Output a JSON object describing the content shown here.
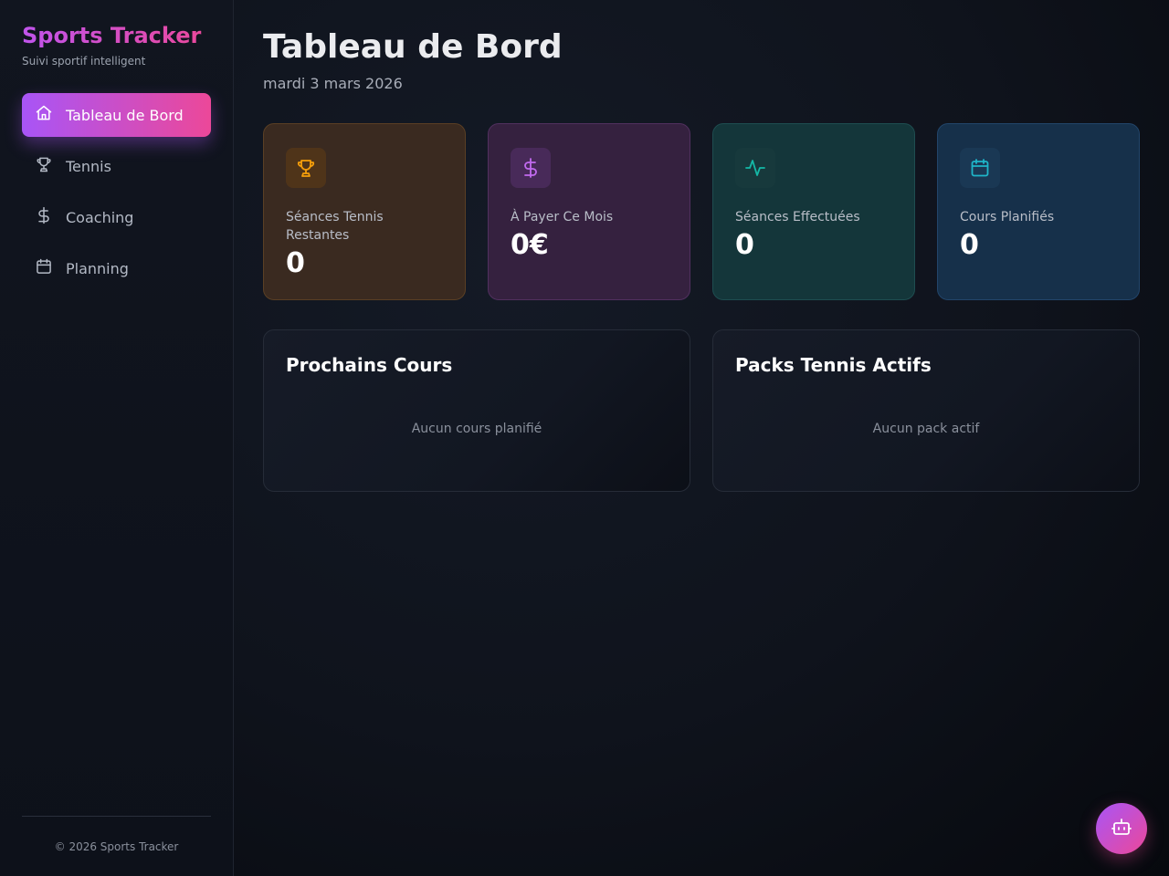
{
  "sidebar": {
    "brand_title": "Sports Tracker",
    "brand_subtitle": "Suivi sportif intelligent",
    "items": [
      {
        "label": "Tableau de Bord",
        "icon": "home-icon",
        "active": true
      },
      {
        "label": "Tennis",
        "icon": "trophy-icon",
        "active": false
      },
      {
        "label": "Coaching",
        "icon": "dollar-icon",
        "active": false
      },
      {
        "label": "Planning",
        "icon": "calendar-icon",
        "active": false
      }
    ],
    "footer": "© 2026 Sports Tracker"
  },
  "header": {
    "title": "Tableau de Bord",
    "date": "mardi 3 mars 2026"
  },
  "stats": [
    {
      "label": "Séances Tennis Restantes",
      "value": "0",
      "icon": "trophy-icon",
      "color": "#f59e0b"
    },
    {
      "label": "À Payer Ce Mois",
      "value": "0€",
      "icon": "dollar-icon",
      "color": "#c26bf0"
    },
    {
      "label": "Séances Effectuées",
      "value": "0",
      "icon": "activity-icon",
      "color": "#14b8a6"
    },
    {
      "label": "Cours Planifiés",
      "value": "0",
      "icon": "calendar-icon",
      "color": "#1fb5c9"
    }
  ],
  "panels": {
    "upcoming": {
      "title": "Prochains Cours",
      "empty": "Aucun cours planifié"
    },
    "packs": {
      "title": "Packs Tennis Actifs",
      "empty": "Aucun pack actif"
    }
  },
  "fab": {
    "icon": "bot-icon"
  },
  "colors": {
    "accent_start": "#a855f7",
    "accent_end": "#ec4899",
    "background": "#0b0e16"
  }
}
